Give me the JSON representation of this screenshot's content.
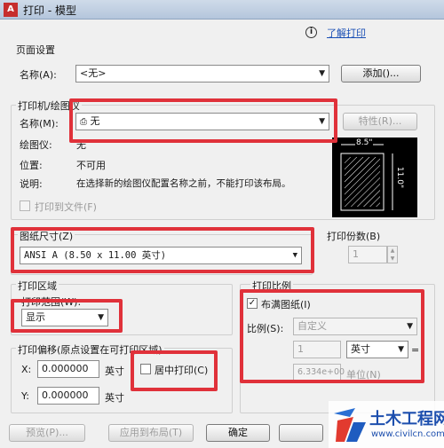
{
  "window": {
    "title": "打印 - 模型",
    "logo_text": "A"
  },
  "help": {
    "icon_glyph": "i",
    "link": "了解打印"
  },
  "page_setup": {
    "group_label": "页面设置",
    "name_label": "名称(A):",
    "name_value": "<无>",
    "add_button": "添加()..."
  },
  "printer": {
    "group_label": "打印机/绘图仪",
    "name_label": "名称(M):",
    "name_value": "无",
    "properties_button": "特性(R)...",
    "plotter_label": "绘图仪:",
    "plotter_value": "无",
    "location_label": "位置:",
    "location_value": "不可用",
    "description_label": "说明:",
    "description_value": "在选择新的绘图仪配置名称之前，不能打印该布局。",
    "print_to_file": "打印到文件(F)"
  },
  "preview": {
    "width_label": "8.5\"",
    "height_label": "11.0\""
  },
  "paper_size": {
    "group_label": "图纸尺寸(Z)",
    "value": "ANSI A (8.50 x 11.00 英寸)"
  },
  "copies": {
    "group_label": "打印份数(B)",
    "value": "1"
  },
  "plot_area": {
    "group_label": "打印区域",
    "range_label": "打印范围(W):",
    "range_value": "显示"
  },
  "plot_scale": {
    "group_label": "打印比例",
    "fit_label": "布满图纸(I)",
    "scale_label": "比例(S):",
    "scale_value": "自定义",
    "value1": "1",
    "unit_value": "英寸",
    "value2": "6.334e+00",
    "unit2_label": "单位(N)",
    "equals": "="
  },
  "plot_offset": {
    "group_label": "打印偏移(原点设置在可打印区域)",
    "x_label": "X:",
    "x_value": "0.000000",
    "x_unit": "英寸",
    "y_label": "Y:",
    "y_value": "0.000000",
    "y_unit": "英寸",
    "center_label": "居中打印(C)"
  },
  "buttons": {
    "preview": "预览(P)...",
    "apply": "应用到布局(T)",
    "ok": "确定"
  },
  "watermark": {
    "brand": "土木工程网",
    "url": "www.civilcn.com"
  },
  "colors": {
    "highlight": "#e0313a",
    "link": "#1a4fb5"
  }
}
